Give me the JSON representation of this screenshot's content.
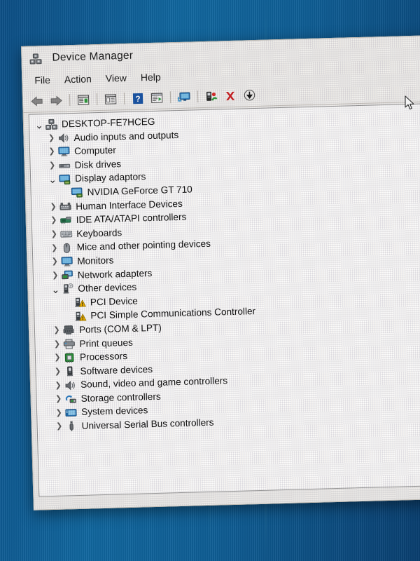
{
  "window": {
    "title": "Device Manager",
    "title_icon": "computer-icon"
  },
  "menubar": {
    "items": [
      {
        "label": "File"
      },
      {
        "label": "Action"
      },
      {
        "label": "View"
      },
      {
        "label": "Help"
      }
    ]
  },
  "toolbar": {
    "buttons": [
      {
        "name": "back-button",
        "icon": "back-arrow-icon"
      },
      {
        "name": "forward-button",
        "icon": "forward-arrow-icon"
      },
      {
        "name": "properties-button",
        "icon": "properties-window-icon"
      },
      {
        "name": "show-hide-console-tree",
        "icon": "console-tree-icon"
      },
      {
        "name": "help-button",
        "icon": "help-question-icon"
      },
      {
        "name": "update-driver-button",
        "icon": "update-driver-icon"
      },
      {
        "name": "scan-hardware-button",
        "icon": "scan-monitor-icon"
      },
      {
        "name": "add-legacy-hardware",
        "icon": "add-hardware-icon"
      },
      {
        "name": "uninstall-device",
        "icon": "red-x-icon"
      },
      {
        "name": "disable-device",
        "icon": "down-arrow-circle-icon"
      }
    ]
  },
  "tree": {
    "root": {
      "label": "DESKTOP-FE7HCEG",
      "icon": "computer-icon",
      "state": "expanded"
    },
    "nodes": [
      {
        "label": "Audio inputs and outputs",
        "icon": "speaker-icon",
        "indent": 1,
        "state": "collapsed"
      },
      {
        "label": "Computer",
        "icon": "monitor-icon",
        "indent": 1,
        "state": "collapsed"
      },
      {
        "label": "Disk drives",
        "icon": "disk-drive-icon",
        "indent": 1,
        "state": "collapsed"
      },
      {
        "label": "Display adaptors",
        "icon": "display-adapter-icon",
        "indent": 1,
        "state": "expanded"
      },
      {
        "label": "NVIDIA GeForce GT 710",
        "icon": "display-adapter-icon",
        "indent": 2,
        "state": "leaf"
      },
      {
        "label": "Human Interface Devices",
        "icon": "hid-icon",
        "indent": 1,
        "state": "collapsed"
      },
      {
        "label": "IDE ATA/ATAPI controllers",
        "icon": "ide-controller-icon",
        "indent": 1,
        "state": "collapsed"
      },
      {
        "label": "Keyboards",
        "icon": "keyboard-icon",
        "indent": 1,
        "state": "collapsed"
      },
      {
        "label": "Mice and other pointing devices",
        "icon": "mouse-icon",
        "indent": 1,
        "state": "collapsed"
      },
      {
        "label": "Monitors",
        "icon": "monitor-icon",
        "indent": 1,
        "state": "collapsed"
      },
      {
        "label": "Network adapters",
        "icon": "network-adapter-icon",
        "indent": 1,
        "state": "collapsed"
      },
      {
        "label": "Other devices",
        "icon": "unknown-device-icon",
        "indent": 1,
        "state": "expanded"
      },
      {
        "label": "PCI Device",
        "icon": "unknown-device-warning-icon",
        "indent": 2,
        "state": "leaf",
        "warning": true
      },
      {
        "label": "PCI Simple Communications Controller",
        "icon": "unknown-device-warning-icon",
        "indent": 2,
        "state": "leaf",
        "warning": true
      },
      {
        "label": "Ports (COM & LPT)",
        "icon": "port-icon",
        "indent": 1,
        "state": "collapsed"
      },
      {
        "label": "Print queues",
        "icon": "printer-icon",
        "indent": 1,
        "state": "collapsed"
      },
      {
        "label": "Processors",
        "icon": "processor-icon",
        "indent": 1,
        "state": "collapsed"
      },
      {
        "label": "Software devices",
        "icon": "software-device-icon",
        "indent": 1,
        "state": "collapsed"
      },
      {
        "label": "Sound, video and game controllers",
        "icon": "speaker-icon",
        "indent": 1,
        "state": "collapsed"
      },
      {
        "label": "Storage controllers",
        "icon": "storage-controller-icon",
        "indent": 1,
        "state": "collapsed"
      },
      {
        "label": "System devices",
        "icon": "system-device-icon",
        "indent": 1,
        "state": "collapsed"
      },
      {
        "label": "Universal Serial Bus controllers",
        "icon": "usb-icon",
        "indent": 1,
        "state": "collapsed"
      }
    ]
  },
  "glyphs": {
    "chevron_collapsed": "❯",
    "chevron_expanded": "⌄"
  },
  "colors": {
    "desktop": "#0f5a93",
    "window_chrome": "#f1f0ee",
    "tree_background": "#fbfbfb",
    "warning": "#f0b400",
    "uninstall_red": "#cc1f22",
    "accent_blue": "#2a6fb5"
  }
}
